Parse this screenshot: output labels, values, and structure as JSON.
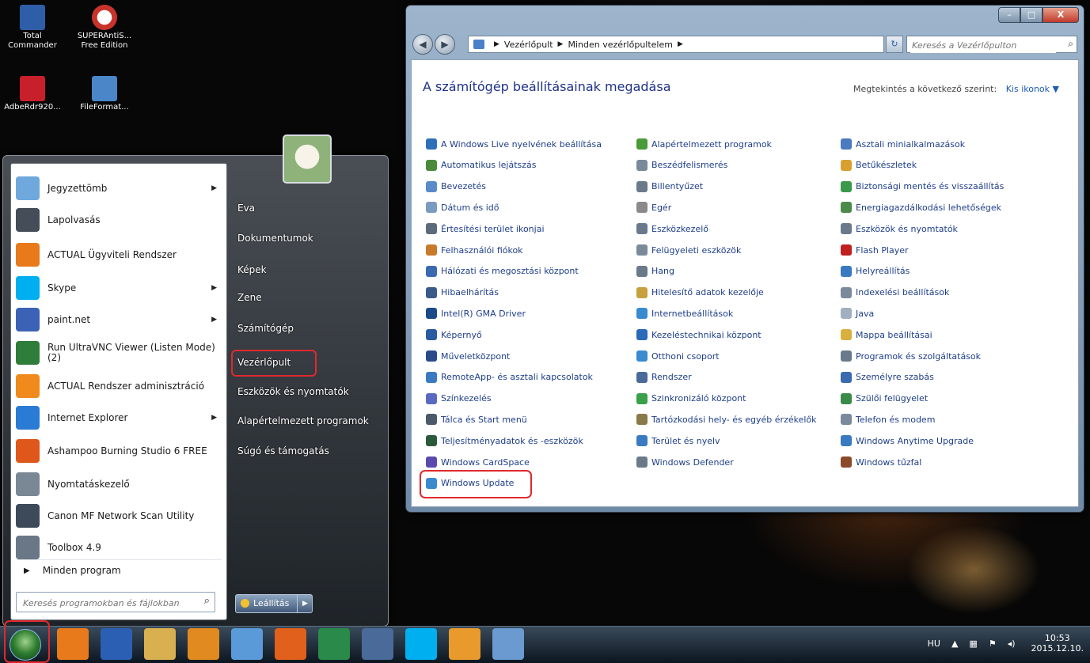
{
  "desktop": {
    "icons": [
      {
        "label": "Total Commander",
        "color": "#2f5ea8"
      },
      {
        "label": "SUPERAntiS... Free Edition",
        "color": "#c8332a"
      },
      {
        "label": "AdbeRdr920...",
        "color": "#c8202a"
      },
      {
        "label": "FileFormat...",
        "color": "#4a86c8"
      }
    ]
  },
  "start_menu": {
    "programs": [
      {
        "label": "Jegyzettömb",
        "arrow": "▶",
        "color": "#6fa8dc"
      },
      {
        "label": "Lapolvasás",
        "arrow": "",
        "color": "#444d58"
      },
      {
        "label": "ACTUAL Ügyviteli Rendszer",
        "arrow": "",
        "color": "#e87a1c"
      },
      {
        "label": "Skype",
        "arrow": "▶",
        "color": "#00aff0"
      },
      {
        "label": "paint.net",
        "arrow": "▶",
        "color": "#3b62b5"
      },
      {
        "label": "Run UltraVNC Viewer (Listen Mode) (2)",
        "arrow": "",
        "color": "#2f7d3a"
      },
      {
        "label": "ACTUAL Rendszer adminisztráció",
        "arrow": "",
        "color": "#f08a1c"
      },
      {
        "label": "Internet Explorer",
        "arrow": "▶",
        "color": "#2a7bd4"
      },
      {
        "label": "Ashampoo Burning Studio 6 FREE",
        "arrow": "",
        "color": "#e0571c"
      },
      {
        "label": "Nyomtatáskezelő",
        "arrow": "",
        "color": "#7a8896"
      },
      {
        "label": "Canon MF Network Scan Utility",
        "arrow": "",
        "color": "#3d4a5a"
      },
      {
        "label": "Toolbox 4.9",
        "arrow": "",
        "color": "#6a7786"
      }
    ],
    "all_programs": "Minden program",
    "search_placeholder": "Keresés programokban és fájlokban",
    "right_links": [
      "Eva",
      "Dokumentumok",
      "Képek",
      "Zene",
      "Számítógép",
      "Vezérlőpult",
      "Eszközök és nyomtatók",
      "Alapértelmezett programok",
      "Súgó és támogatás"
    ],
    "shutdown": "Leállítás"
  },
  "control_panel": {
    "breadcrumb": [
      "Vezérlőpult",
      "Minden vezérlőpultelem"
    ],
    "search_placeholder": "Keresés a Vezérlőpulton",
    "heading": "A számítógép beállításainak megadása",
    "view_by_label": "Megtekintés a következő szerint:",
    "view_by_value": "Kis ikonok ▼",
    "columns": [
      [
        {
          "label": "A Windows Live nyelvének beállítása",
          "color": "#2f6fb8"
        },
        {
          "label": "Automatikus lejátszás",
          "color": "#4a8a3a"
        },
        {
          "label": "Bevezetés",
          "color": "#5a8ac8"
        },
        {
          "label": "Dátum és idő",
          "color": "#7a9ac0"
        },
        {
          "label": "Értesítési terület ikonjai",
          "color": "#5b6b7b"
        },
        {
          "label": "Felhasználói fiókok",
          "color": "#c87a2a"
        },
        {
          "label": "Hálózati és megosztási központ",
          "color": "#3a6ab0"
        },
        {
          "label": "Hibaelhárítás",
          "color": "#3a5a8a"
        },
        {
          "label": "Intel(R) GMA Driver",
          "color": "#1a4a8a"
        },
        {
          "label": "Képernyő",
          "color": "#2a5aa0"
        },
        {
          "label": "Műveletközpont",
          "color": "#2a4a8a"
        },
        {
          "label": "RemoteApp- és asztali kapcsolatok",
          "color": "#3a7ac0"
        },
        {
          "label": "Színkezelés",
          "color": "#5a6ac0"
        },
        {
          "label": "Tálca és Start menü",
          "color": "#4a5a6a"
        },
        {
          "label": "Teljesítményadatok és -eszközök",
          "color": "#2a5a3a"
        },
        {
          "label": "Windows CardSpace",
          "color": "#5a4ab0"
        },
        {
          "label": "Windows Update",
          "color": "#3a8ad0"
        }
      ],
      [
        {
          "label": "Alapértelmezett programok",
          "color": "#4a9a3a"
        },
        {
          "label": "Beszédfelismerés",
          "color": "#7a8a9a"
        },
        {
          "label": "Billentyűzet",
          "color": "#6a7a8a"
        },
        {
          "label": "Egér",
          "color": "#8a8a8a"
        },
        {
          "label": "Eszközkezelő",
          "color": "#6a7a8a"
        },
        {
          "label": "Felügyeleti eszközök",
          "color": "#7a8a9a"
        },
        {
          "label": "Hang",
          "color": "#6a7a8a"
        },
        {
          "label": "Hitelesítő adatok kezelője",
          "color": "#c8a040"
        },
        {
          "label": "Internetbeállítások",
          "color": "#3a8ad0"
        },
        {
          "label": "Kezeléstechnikai központ",
          "color": "#2a6ab8"
        },
        {
          "label": "Otthoni csoport",
          "color": "#3a8ad0"
        },
        {
          "label": "Rendszer",
          "color": "#4a6a9a"
        },
        {
          "label": "Szinkronizáló központ",
          "color": "#3aa04a"
        },
        {
          "label": "Tartózkodási hely- és egyéb érzékelők",
          "color": "#8a7a4a"
        },
        {
          "label": "Terület és nyelv",
          "color": "#3a7ac0"
        },
        {
          "label": "Windows Defender",
          "color": "#6a7a8a"
        }
      ],
      [
        {
          "label": "Asztali minialkalmazások",
          "color": "#4a7ac0"
        },
        {
          "label": "Betűkészletek",
          "color": "#d8a030"
        },
        {
          "label": "Biztonsági mentés és visszaállítás",
          "color": "#3a9a4a"
        },
        {
          "label": "Energiagazdálkodási lehetőségek",
          "color": "#4a8a4a"
        },
        {
          "label": "Eszközök és nyomtatók",
          "color": "#6a7a8a"
        },
        {
          "label": "Flash Player",
          "color": "#c02020"
        },
        {
          "label": "Helyreállítás",
          "color": "#3a7ac0"
        },
        {
          "label": "Indexelési beállítások",
          "color": "#7a8a9a"
        },
        {
          "label": "Java",
          "color": "#a0b0c0"
        },
        {
          "label": "Mappa beállításai",
          "color": "#d8b040"
        },
        {
          "label": "Programok és szolgáltatások",
          "color": "#6a7a8a"
        },
        {
          "label": "Személyre szabás",
          "color": "#3a6ab0"
        },
        {
          "label": "Szülői felügyelet",
          "color": "#3a8a4a"
        },
        {
          "label": "Telefon és modem",
          "color": "#7a8a9a"
        },
        {
          "label": "Windows Anytime Upgrade",
          "color": "#3a7ac0"
        },
        {
          "label": "Windows tűzfal",
          "color": "#8a4a2a"
        }
      ]
    ]
  },
  "taskbar": {
    "apps": [
      {
        "name": "actual-icon",
        "color": "#e87a1c"
      },
      {
        "name": "word-icon",
        "color": "#2b5fb4"
      },
      {
        "name": "explorer-icon",
        "color": "#d8b050"
      },
      {
        "name": "media-player-icon",
        "color": "#e08a20"
      },
      {
        "name": "security-icon",
        "color": "#5a9ad8"
      },
      {
        "name": "firefox-icon",
        "color": "#e0601c"
      },
      {
        "name": "excel-icon",
        "color": "#2a8a4a"
      },
      {
        "name": "network-icon",
        "color": "#4a6a9a"
      },
      {
        "name": "skype-icon",
        "color": "#00aff0"
      },
      {
        "name": "actual-erp-icon",
        "color": "#e89a2c"
      },
      {
        "name": "control-panel-icon",
        "color": "#6a9ad0"
      }
    ],
    "lang": "HU",
    "time": "10:53",
    "date": "2015.12.10."
  }
}
